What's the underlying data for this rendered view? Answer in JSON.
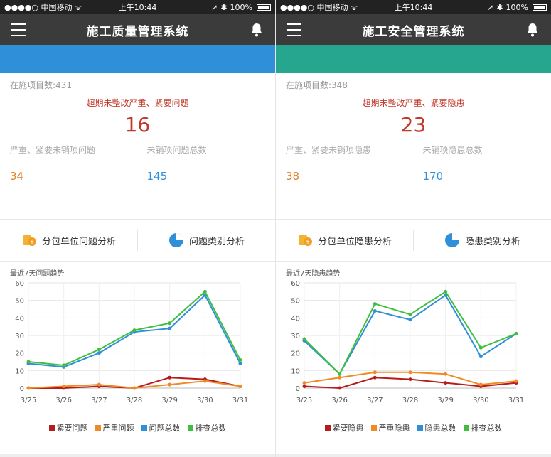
{
  "colors": {
    "quality_bar": "#2f8fd8",
    "safety_bar": "#26a58f",
    "navbar": "#3b3b3b"
  },
  "status_bar": {
    "carrier": "●●●●○ 中国移动 ᯤ",
    "time": "上午10:44",
    "battery": "100%"
  },
  "panels": [
    {
      "title": "施工质量管理系统",
      "ongoing": "在施项目数:431",
      "alert_label": "超期未整改严重、紧要问题",
      "alert_count": "16",
      "left_label": "严重、紧要未销项问题",
      "right_label": "未销项问题总数",
      "left_value": "34",
      "right_value": "145",
      "tabs": [
        {
          "label": "分包单位问题分析",
          "icon": "coins-icon"
        },
        {
          "label": "问题类别分析",
          "icon": "pie-chart-icon"
        }
      ],
      "chart_title": "最近7天问题趋势",
      "chart_data": {
        "type": "line",
        "x": [
          "3/25",
          "3/26",
          "3/27",
          "3/28",
          "3/29",
          "3/30",
          "3/31"
        ],
        "ylim": [
          0,
          60
        ],
        "yticks": [
          "0",
          "10",
          "20",
          "30",
          "40",
          "50",
          "60"
        ],
        "legend_position": "bottom",
        "series": [
          {
            "name": "紧要问题",
            "color": "#b71c1c",
            "values": [
              0,
              0,
              1,
              0,
              6,
              5,
              1
            ]
          },
          {
            "name": "严重问题",
            "color": "#f08a24",
            "values": [
              0,
              1,
              2,
              0,
              2,
              4,
              1
            ]
          },
          {
            "name": "问题总数",
            "color": "#2f8fd8",
            "values": [
              14,
              12,
              20,
              32,
              34,
              53,
              14
            ]
          },
          {
            "name": "排查总数",
            "color": "#3fbf3f",
            "values": [
              15,
              13,
              22,
              33,
              37,
              55,
              16
            ]
          }
        ]
      }
    },
    {
      "title": "施工安全管理系统",
      "ongoing": "在施项目数:348",
      "alert_label": "超期未整改严重、紧要隐患",
      "alert_count": "23",
      "left_label": "严重、紧要未销项隐患",
      "right_label": "未销项隐患总数",
      "left_value": "38",
      "right_value": "170",
      "tabs": [
        {
          "label": "分包单位隐患分析",
          "icon": "coins-icon"
        },
        {
          "label": "隐患类别分析",
          "icon": "pie-chart-icon"
        }
      ],
      "chart_title": "最近7天隐患趋势",
      "chart_data": {
        "type": "line",
        "x": [
          "3/25",
          "3/26",
          "3/27",
          "3/28",
          "3/29",
          "3/30",
          "3/31"
        ],
        "ylim": [
          0,
          60
        ],
        "yticks": [
          "0",
          "10",
          "20",
          "30",
          "40",
          "50",
          "60"
        ],
        "legend_position": "bottom",
        "series": [
          {
            "name": "紧要隐患",
            "color": "#b71c1c",
            "values": [
              1,
              0,
              6,
              5,
              3,
              1,
              3
            ]
          },
          {
            "name": "严重隐患",
            "color": "#f08a24",
            "values": [
              3,
              6,
              9,
              9,
              8,
              2,
              4
            ]
          },
          {
            "name": "隐患总数",
            "color": "#2f8fd8",
            "values": [
              27,
              8,
              44,
              39,
              53,
              18,
              31
            ]
          },
          {
            "name": "排查总数",
            "color": "#3fbf3f",
            "values": [
              28,
              8,
              48,
              42,
              55,
              23,
              31
            ]
          }
        ]
      }
    }
  ]
}
